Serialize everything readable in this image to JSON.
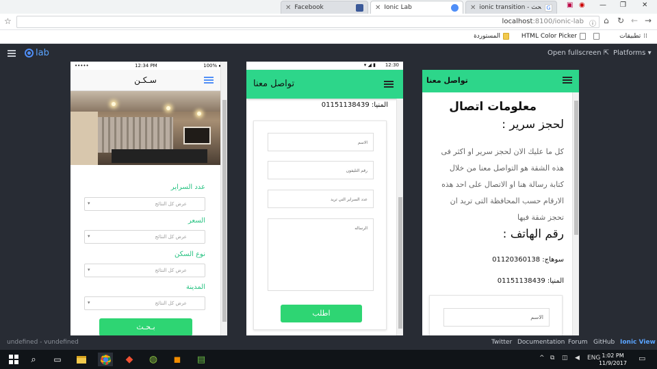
{
  "browser": {
    "tabs": [
      {
        "label": "Facebook",
        "color": "#3b5998"
      },
      {
        "label": "Ionic Lab",
        "color": "#4f8ef7"
      },
      {
        "label": "ionic transition - بحث Go",
        "color": "#4285f4"
      }
    ],
    "url_host": "localhost",
    "url_path": ":8100/ionic-lab",
    "bookmarks": {
      "apps": "تطبيقات",
      "color_picker": "HTML Color Picker",
      "imported": "المستوردة"
    }
  },
  "lab": {
    "logo_text": "lab",
    "open_fullscreen": "Open fullscreen",
    "platforms": "Platforms",
    "footer_status": "undefined - vundefined",
    "footer_links": [
      "Twitter",
      "Documentation",
      "Forum",
      "GitHub",
      "Ionic View"
    ],
    "accent": "#2dd68a"
  },
  "ios": {
    "status_carrier": "•••••",
    "status_time": "12:34 PM",
    "status_battery": "100%",
    "title": "سـكـن",
    "fields": [
      {
        "label": "عدد السراير",
        "placeholder": "عرض كل النتائج"
      },
      {
        "label": "السعر",
        "placeholder": "عرض كل النتائج"
      },
      {
        "label": "نوع السكن",
        "placeholder": "عرض كل النتائج"
      },
      {
        "label": "المدينة",
        "placeholder": "عرض كل النتائج"
      }
    ],
    "search_button": "بـحـث"
  },
  "android": {
    "status_time": "12:30",
    "title": "تواصل معنا",
    "phone_line": "المنيا: 01151138439",
    "inputs": [
      "الاسم",
      "رقم التليفون",
      "عدد السراير التي تريد",
      "الرساله"
    ],
    "submit": "اطلب"
  },
  "wp": {
    "title": "تواصل معنا",
    "heading": "معلومات اتصال",
    "booking_heading": "لحجز سرير :",
    "paragraph": [
      "كل ما عليك الان لحجز سرير او اكثر فى",
      "هذه الشقة هو التواصل معنا من خلال",
      "كتابة رسالة هنا او الاتصال على احد هذه",
      "الارقام حسب المحافظة التى تريد ان",
      "تحجز شقة فيها"
    ],
    "phone_heading": "رقم الهاتف :",
    "phone_sohag": "سوهاج: 01120360138",
    "phone_minya": "المنيا: 01151138439",
    "name_placeholder": "الاسم"
  },
  "taskbar": {
    "lang": "ENG",
    "time": "1:02 PM",
    "date": "11/9/2017"
  }
}
